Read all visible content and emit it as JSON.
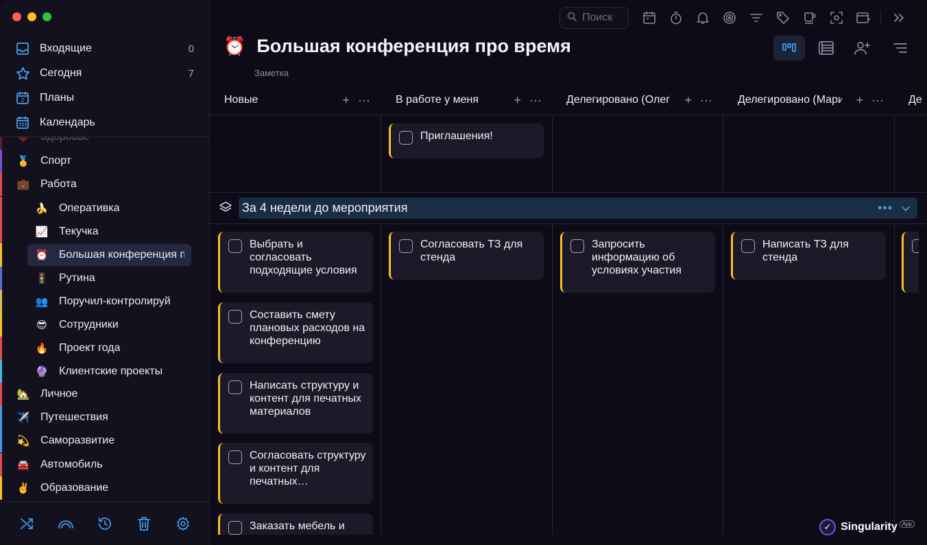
{
  "sidebar": {
    "nav": [
      {
        "label": "Входящие",
        "count": "0",
        "icon": "inbox-icon"
      },
      {
        "label": "Сегодня",
        "count": "7",
        "icon": "star-icon"
      },
      {
        "label": "Планы",
        "count": "",
        "icon": "calendar-2-icon"
      },
      {
        "label": "Календарь",
        "count": "",
        "icon": "calendar-grid-icon"
      }
    ],
    "projects": [
      {
        "label": "Здоровье",
        "emoji": "❤️",
        "color": "#d64545",
        "level": 0,
        "faded": true
      },
      {
        "label": "Спорт",
        "emoji": "🥇",
        "color": "#7a4fd6",
        "level": 0
      },
      {
        "label": "Работа",
        "emoji": "💼",
        "color": "#e24b4b",
        "level": 0
      },
      {
        "label": "Оперативка",
        "emoji": "🍌",
        "color": "#e24b4b",
        "level": 1
      },
      {
        "label": "Текучка",
        "emoji": "📈",
        "color": "#e24b4b",
        "level": 1
      },
      {
        "label": "Большая конференция про время",
        "emoji": "⏰",
        "color": "#f3c126",
        "level": 1,
        "active": true
      },
      {
        "label": "Рутина",
        "emoji": "🚦",
        "color": "#5b6ad6",
        "level": 1
      },
      {
        "label": "Поручил-контролируй",
        "emoji": "👥",
        "color": "#d6c14f",
        "level": 1
      },
      {
        "label": "Сотрудники",
        "emoji": "😎",
        "color": "#f3c126",
        "level": 1
      },
      {
        "label": "Проект года",
        "emoji": "🔥",
        "color": "#e24b4b",
        "level": 1
      },
      {
        "label": "Клиентские проекты",
        "emoji": "🔮",
        "color": "#3dbbe6",
        "level": 1
      },
      {
        "label": "Личное",
        "emoji": "🏡",
        "color": "#e24b4b",
        "level": 0
      },
      {
        "label": "Путешествия",
        "emoji": "✈️",
        "color": "#3d9be9",
        "level": 0
      },
      {
        "label": "Саморазвитие",
        "emoji": "💫",
        "color": "#3d9be9",
        "level": 0
      },
      {
        "label": "Автомобиль",
        "emoji": "🚘",
        "color": "#e24b4b",
        "level": 0
      },
      {
        "label": "Образование",
        "emoji": "✌️",
        "color": "#f3c126",
        "level": 0
      }
    ],
    "bottom_icons": [
      "shuffle-icon",
      "rainbow-icon",
      "history-icon",
      "trash-icon",
      "settings-icon"
    ]
  },
  "toolbar": {
    "search_placeholder": "Поиск",
    "icons": [
      "calendar-icon",
      "timer-icon",
      "bell-icon",
      "focus-icon",
      "filter-icon",
      "tag-icon",
      "coffee-icon",
      "scan-icon",
      "window-icon",
      "expand-icon"
    ]
  },
  "page": {
    "emoji": "⏰",
    "title": "Большая конференция про время",
    "subtitle": "Заметка"
  },
  "view_icons": [
    "kanban-view-icon",
    "list-view-icon",
    "add-person-icon",
    "sort-icon"
  ],
  "columns": [
    {
      "label": "Новые"
    },
    {
      "label": "В работе у меня"
    },
    {
      "label": "Делегировано (Олег)"
    },
    {
      "label": "Делегировано (Мария)"
    },
    {
      "label": "Де"
    }
  ],
  "top_cards": [
    {
      "col": 1,
      "text": "Приглашения!"
    }
  ],
  "section": {
    "title": "За 4 недели до мероприятия",
    "dots": "•••"
  },
  "cards": [
    {
      "col": 0,
      "text": "Выбрать и согласовать подходящие условия"
    },
    {
      "col": 0,
      "text": "Составить смету плановых расходов на конференцию"
    },
    {
      "col": 0,
      "text": "Написать структуру и контент для печатных материалов"
    },
    {
      "col": 0,
      "text": "Согласовать структуру и контент для печатных…"
    },
    {
      "col": 0,
      "text": "Заказать мебель и"
    },
    {
      "col": 1,
      "text": "Согласовать ТЗ для стенда"
    },
    {
      "col": 2,
      "text": "Запросить информацию об условиях участия"
    },
    {
      "col": 3,
      "text": "Написать ТЗ для стенда"
    }
  ],
  "brand": {
    "name": "Singularity",
    "tag": "App"
  }
}
